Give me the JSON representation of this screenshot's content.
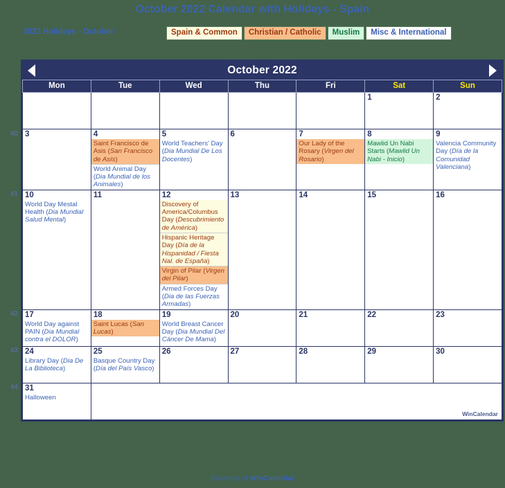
{
  "page": {
    "title": "October 2022 Calendar with Holidays - Spain",
    "background_color": "#44634a",
    "accent_color": "#2b3566",
    "link_color": "#3c62b4"
  },
  "legend": {
    "label": "2022 Holidays - October:",
    "categories": [
      {
        "key": "spain",
        "label": "Spain & Common",
        "bg": "#fdfce0",
        "fg": "#9c3a10"
      },
      {
        "key": "christian",
        "label": "Christian / Catholic",
        "bg": "#f8bd8b",
        "fg": "#9c3a10"
      },
      {
        "key": "muslim",
        "label": "Muslim",
        "bg": "#d4f5dd",
        "fg": "#127a42"
      },
      {
        "key": "misc",
        "label": "Misc & International",
        "bg": "#fefefe",
        "fg": "#3c62b4"
      }
    ]
  },
  "calendar": {
    "month_title": "October 2022",
    "prev_label": "◀",
    "next_label": "▶",
    "weekday_headers": [
      "Mon",
      "Tue",
      "Wed",
      "Thu",
      "Fri",
      "Sat",
      "Sun"
    ],
    "weekend_headers": [
      "Sat",
      "Sun"
    ],
    "week_numbers": [
      "40",
      "41",
      "42",
      "43",
      "44"
    ],
    "weeks": [
      {
        "week_number": "",
        "days": [
          {
            "num": "",
            "blank": true,
            "weekend": false,
            "events": []
          },
          {
            "num": "",
            "blank": true,
            "weekend": false,
            "events": []
          },
          {
            "num": "",
            "blank": true,
            "weekend": false,
            "events": []
          },
          {
            "num": "",
            "blank": true,
            "weekend": false,
            "events": []
          },
          {
            "num": "",
            "blank": true,
            "weekend": false,
            "events": []
          },
          {
            "num": "1",
            "blank": false,
            "weekend": true,
            "events": []
          },
          {
            "num": "2",
            "blank": false,
            "weekend": true,
            "events": []
          }
        ]
      },
      {
        "week_number": "40",
        "days": [
          {
            "num": "3",
            "blank": false,
            "weekend": false,
            "events": []
          },
          {
            "num": "4",
            "blank": false,
            "weekend": false,
            "events": [
              {
                "cat": "christian",
                "en": "Saint Francisco de Asis (",
                "es": "San Francisco de Asís",
                "tail": ")"
              },
              {
                "cat": "misc",
                "en": "World Animal Day (",
                "es": "Dia Mundial de los Animales",
                "tail": ")"
              }
            ]
          },
          {
            "num": "5",
            "blank": false,
            "weekend": false,
            "events": [
              {
                "cat": "misc",
                "en": "World Teachers' Day (",
                "es": "Dia Mundial De Los Docentes",
                "tail": ")"
              }
            ]
          },
          {
            "num": "6",
            "blank": false,
            "weekend": false,
            "events": []
          },
          {
            "num": "7",
            "blank": false,
            "weekend": false,
            "events": [
              {
                "cat": "christian",
                "en": "Our Lady of the Rosary (",
                "es": "Virgen del Rosario",
                "tail": ")"
              }
            ]
          },
          {
            "num": "8",
            "blank": false,
            "weekend": true,
            "events": [
              {
                "cat": "muslim",
                "en": "Mawlid Un Nabi Starts (",
                "es": "Mawlid Un Nabi - Inicio",
                "tail": ")"
              }
            ]
          },
          {
            "num": "9",
            "blank": false,
            "weekend": true,
            "events": [
              {
                "cat": "misc",
                "en": "Valencia Community Day (",
                "es": "Día de la Comunidad Valenciana",
                "tail": ")"
              }
            ]
          }
        ]
      },
      {
        "week_number": "41",
        "days": [
          {
            "num": "10",
            "blank": false,
            "weekend": false,
            "events": [
              {
                "cat": "misc",
                "en": "World Day Mestal Health (",
                "es": "Dia Mundial Salud Mental",
                "tail": ")"
              }
            ]
          },
          {
            "num": "11",
            "blank": false,
            "weekend": false,
            "events": []
          },
          {
            "num": "12",
            "blank": false,
            "weekend": false,
            "events": [
              {
                "cat": "spain",
                "en": "Discovery of America/Columbus Day (",
                "es": "Descubrimiento de América",
                "tail": ")"
              },
              {
                "cat": "spain",
                "en": "Hispanic Heritage Day (",
                "es": "Día de la Hispanidad / Fiesta Nal. de España",
                "tail": ")"
              },
              {
                "cat": "christian",
                "en": "Virgin of Pilar (",
                "es": "Virgen del Pilar",
                "tail": ")"
              },
              {
                "cat": "misc",
                "en": "Armed Forces Day (",
                "es": "Dia de las Fuerzas Armadas",
                "tail": ")"
              }
            ]
          },
          {
            "num": "13",
            "blank": false,
            "weekend": false,
            "events": []
          },
          {
            "num": "14",
            "blank": false,
            "weekend": false,
            "events": []
          },
          {
            "num": "15",
            "blank": false,
            "weekend": true,
            "events": []
          },
          {
            "num": "16",
            "blank": false,
            "weekend": true,
            "events": []
          }
        ]
      },
      {
        "week_number": "42",
        "days": [
          {
            "num": "17",
            "blank": false,
            "weekend": false,
            "events": [
              {
                "cat": "misc",
                "en": "World Day against PAIN (",
                "es": "Dia Mundial contra el DOLOR",
                "tail": ")"
              }
            ]
          },
          {
            "num": "18",
            "blank": false,
            "weekend": false,
            "events": [
              {
                "cat": "christian",
                "en": "Saint Lucas (",
                "es": "San Lucas",
                "tail": ")"
              }
            ]
          },
          {
            "num": "19",
            "blank": false,
            "weekend": false,
            "events": [
              {
                "cat": "misc",
                "en": "World Breast Cancer Day (",
                "es": "Dia Mundial Del Cáncer De Mama",
                "tail": ")"
              }
            ]
          },
          {
            "num": "20",
            "blank": false,
            "weekend": false,
            "events": []
          },
          {
            "num": "21",
            "blank": false,
            "weekend": false,
            "events": []
          },
          {
            "num": "22",
            "blank": false,
            "weekend": true,
            "events": []
          },
          {
            "num": "23",
            "blank": false,
            "weekend": true,
            "events": []
          }
        ]
      },
      {
        "week_number": "43",
        "days": [
          {
            "num": "24",
            "blank": false,
            "weekend": false,
            "events": [
              {
                "cat": "misc",
                "en": "Library Day (",
                "es": "Dia De La Biblioteca",
                "tail": ")"
              }
            ]
          },
          {
            "num": "25",
            "blank": false,
            "weekend": false,
            "events": [
              {
                "cat": "misc",
                "en": "Basque Country Day (",
                "es": "Día del País Vasco",
                "tail": ")"
              }
            ]
          },
          {
            "num": "26",
            "blank": false,
            "weekend": false,
            "events": []
          },
          {
            "num": "27",
            "blank": false,
            "weekend": false,
            "events": []
          },
          {
            "num": "28",
            "blank": false,
            "weekend": false,
            "events": []
          },
          {
            "num": "29",
            "blank": false,
            "weekend": true,
            "events": []
          },
          {
            "num": "30",
            "blank": false,
            "weekend": true,
            "events": []
          }
        ]
      },
      {
        "week_number": "44",
        "days": [
          {
            "num": "31",
            "blank": false,
            "weekend": false,
            "events": [
              {
                "cat": "misc",
                "en": "Halloween",
                "es": "",
                "tail": ""
              }
            ]
          },
          {
            "num": "",
            "blank": true,
            "weekend": false,
            "events": []
          },
          {
            "num": "",
            "blank": true,
            "weekend": false,
            "events": []
          },
          {
            "num": "",
            "blank": true,
            "weekend": false,
            "events": []
          },
          {
            "num": "",
            "blank": true,
            "weekend": false,
            "events": []
          },
          {
            "num": "",
            "blank": true,
            "weekend": false,
            "events": []
          },
          {
            "num": "",
            "blank": true,
            "weekend": false,
            "events": []
          }
        ]
      }
    ],
    "watermark": "WinCalendar"
  },
  "footer": {
    "prefix": "Courtesy of ",
    "brand": "WinCalendar"
  }
}
